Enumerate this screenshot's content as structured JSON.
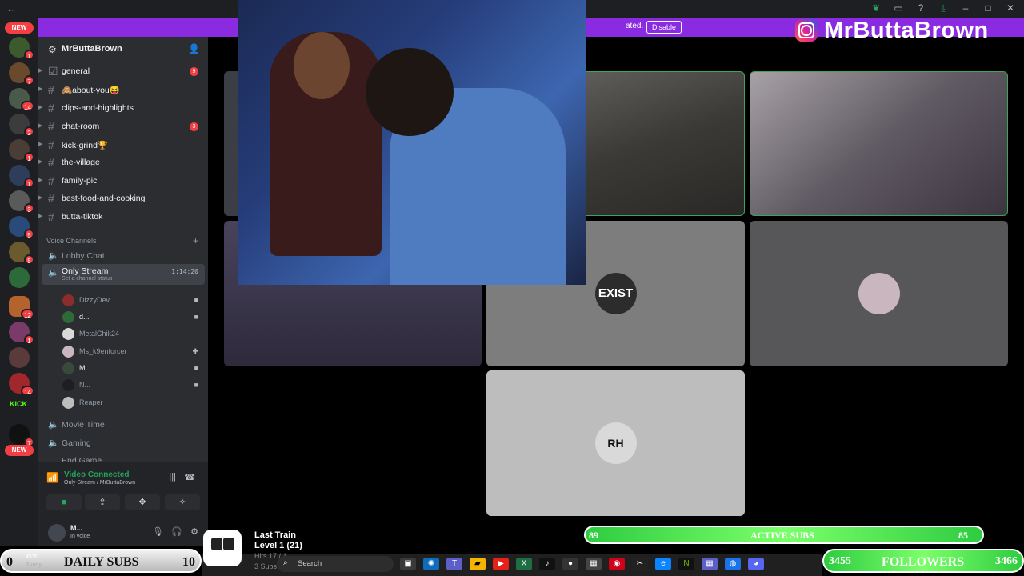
{
  "titlebar": {
    "back_icon": "arrow-left-icon",
    "icons": [
      "leaf-icon",
      "inbox-icon",
      "help-icon",
      "download-icon",
      "minimize-icon",
      "maximize-icon",
      "close-icon"
    ]
  },
  "banner": {
    "text": "ated.",
    "button": "Disable",
    "brand": "MrButtaBrown"
  },
  "rail": {
    "new_top": "NEW",
    "new_bottom": "NEW",
    "kick": "KICK",
    "badges": [
      "1",
      "7",
      "14",
      "2",
      "1",
      "1",
      "3",
      "5",
      "5",
      "",
      "12",
      "1",
      "",
      "1",
      "14",
      "",
      "7"
    ]
  },
  "server": {
    "name": "MrButtaBrown"
  },
  "text_channels": [
    {
      "label": "general",
      "badge": "9"
    },
    {
      "label": "🙈about-you😝",
      "badge": ""
    },
    {
      "label": "clips-and-highlights",
      "badge": ""
    },
    {
      "label": "chat-room",
      "badge": "3"
    },
    {
      "label": "kick-grind🏆",
      "badge": ""
    },
    {
      "label": "the-village",
      "badge": ""
    },
    {
      "label": "family-pic",
      "badge": ""
    },
    {
      "label": "best-food-and-cooking",
      "badge": ""
    },
    {
      "label": "butta-tiktok",
      "badge": ""
    }
  ],
  "voice": {
    "header": "Voice Channels",
    "lobby": "Lobby Chat",
    "active": {
      "label": "Only Stream",
      "status": "Set a channel status",
      "timer": "1:14:20"
    },
    "members": [
      "DizzyDev",
      "d...",
      "MetalChik24",
      "Ms_k9enforcer",
      "M...",
      "N...",
      "Reaper"
    ],
    "others": [
      "Movie Time",
      "Gaming",
      "End Game"
    ]
  },
  "voice_panel": {
    "title": "Video Connected",
    "subtitle": "Only Stream / MrButtaBrown"
  },
  "user_panel": {
    "name": "M...",
    "status": "In voice"
  },
  "tiles": {
    "exist": "EXIST",
    "rh": "RH"
  },
  "overlays": {
    "active_subs": {
      "label": "ACTIVE SUBS",
      "left": "89",
      "right": "85"
    },
    "daily_subs": {
      "label": "DAILY SUBS",
      "left": "0",
      "right": "10"
    },
    "followers": {
      "label": "FOLLOWERS",
      "left": "3455",
      "right": "3466"
    },
    "train": {
      "title": "Last Train",
      "level": "Level 1 (21)",
      "hits": "Hits 17 / 1",
      "subs": "3 Subs"
    }
  },
  "taskbar": {
    "weather_temp": "45°F",
    "weather_text": "Sunny",
    "search": "Search"
  }
}
